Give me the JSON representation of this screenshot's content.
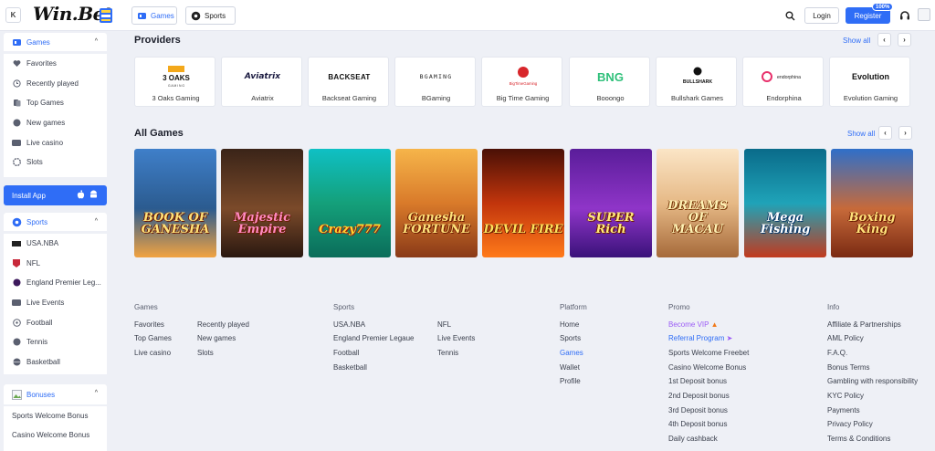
{
  "header": {
    "collapse_icon": "collapse-icon",
    "logo_text": "Win.Bet",
    "tabs": [
      {
        "label": "Games",
        "icon": "games-icon"
      },
      {
        "label": "Sports",
        "icon": "soccer-ball-icon"
      }
    ],
    "login_label": "Login",
    "register_label": "Register",
    "register_badge": "100%",
    "accent_color": "#2f6df6"
  },
  "sidebar": {
    "games_group": {
      "title": "Games",
      "items": [
        "Favorites",
        "Recently played",
        "Top Games",
        "New games",
        "Live casino",
        "Slots"
      ]
    },
    "install_app": "Install App",
    "sports_group": {
      "title": "Sports",
      "items": [
        "USA.NBA",
        "NFL",
        "England Premier Leg...",
        "Live Events",
        "Football",
        "Tennis",
        "Basketball"
      ]
    },
    "bonuses_group": {
      "title": "Bonuses",
      "items": [
        "Sports Welcome Bonus",
        "Casino Welcome Bonus"
      ]
    }
  },
  "providers": {
    "title": "Providers",
    "show_all": "Show all",
    "logos": [
      {
        "line1": "3 OAKS",
        "line2": "G A M I N G"
      },
      {
        "line1": "Aviatrix"
      },
      {
        "line1": "BACKSEAT"
      },
      {
        "line1": "BGAMING"
      },
      {
        "line1": "BigTimeGaming"
      },
      {
        "line1": "BNG"
      },
      {
        "line1": "BULLSHARK"
      },
      {
        "line1": "endorphina"
      },
      {
        "line1": "Evolution"
      }
    ],
    "items": [
      "3 Oaks Gaming",
      "Aviatrix",
      "Backseat Gaming",
      "BGaming",
      "Big Time Gaming",
      "Booongo",
      "Bullshark Games",
      "Endorphina",
      "Evolution Gaming"
    ]
  },
  "all_games": {
    "title": "All Games",
    "show_all": "Show all",
    "items": [
      "BOOK OF\nGANESHA",
      "Majestic\nEmpire",
      "Crazy777",
      "Ganesha\nFORTUNE",
      "DEVIL FIRE",
      "SUPER\nRich",
      "DREAMS OF\nMACAU",
      "Mega Fishing",
      "Boxing King"
    ]
  },
  "footer": {
    "columns": [
      {
        "title": "Games",
        "links": [
          "Favorites",
          "Recently played",
          "Top Games",
          "New games",
          "Live casino",
          "Slots"
        ]
      },
      {
        "title": "Sports",
        "links": [
          "USA.NBA",
          "NFL",
          "England Premier Legaue",
          "Live Events",
          "Football",
          "Tennis",
          "Basketball"
        ]
      },
      {
        "title": "Platform",
        "links": [
          "Home",
          "Sports",
          "Games",
          "Wallet",
          "Profile"
        ]
      },
      {
        "title": "Promo",
        "links": [
          "Become VIP",
          "Referral Program",
          "Sports Welcome Freebet",
          "Casino Welcome Bonus",
          "1st Deposit bonus",
          "2nd Deposit bonus",
          "3rd Deposit bonus",
          "4th Deposit bonus",
          "Daily cashback"
        ]
      },
      {
        "title": "Info",
        "links": [
          "Affiliate & Partnerships",
          "AML Policy",
          "F.A.Q.",
          "Bonus Terms",
          "Gambling with responsibility",
          "KYC Policy",
          "Payments",
          "Privacy Policy",
          "Terms & Conditions"
        ]
      }
    ],
    "promo_color": "#9b5cf6",
    "active_color": "#2f6df6"
  }
}
